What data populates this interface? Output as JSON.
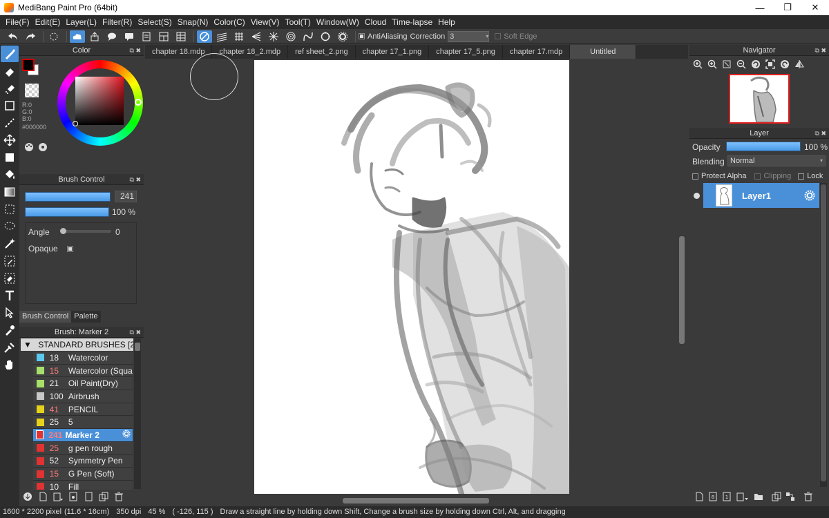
{
  "app": {
    "title": "MediBang Paint Pro (64bit)",
    "window_controls": [
      "—",
      "❐",
      "✕"
    ]
  },
  "menu": [
    "File(F)",
    "Edit(E)",
    "Layer(L)",
    "Filter(R)",
    "Select(S)",
    "Snap(N)",
    "Color(C)",
    "View(V)",
    "Tool(T)",
    "Window(W)",
    "Cloud",
    "Time-lapse",
    "Help"
  ],
  "toolbar": {
    "antialiasing_label": "AntiAliasing",
    "correction_label": "Correction",
    "correction_value": "3",
    "soft_edge_label": "Soft Edge"
  },
  "color_panel": {
    "title": "Color",
    "r": "R:0",
    "g": "G:0",
    "b": "B:0",
    "hex": "#000000",
    "foreground": "#000000",
    "background": "#ffffff",
    "accent": "#cc0000"
  },
  "brush_control": {
    "title": "Brush Control",
    "size_value": "241",
    "opacity_value": "100 %",
    "angle_label": "Angle",
    "angle_value": "0",
    "opaque_label": "Opaque",
    "tab_brush_control": "Brush Control",
    "tab_palette": "Palette"
  },
  "brush_panel": {
    "title": "Brush: Marker 2",
    "group": "STANDARD BRUSHES [2",
    "items": [
      {
        "size": "18",
        "name": "Watercolor",
        "color": "#5bc8f0",
        "size_color": "#eeeeee"
      },
      {
        "size": "15",
        "name": "Watercolor (Squa",
        "color": "#a6e06a",
        "size_color": "#ff7a7a"
      },
      {
        "size": "21",
        "name": "Oil Paint(Dry)",
        "color": "#a6e06a",
        "size_color": "#eeeeee"
      },
      {
        "size": "100",
        "name": "Airbrush",
        "color": "#c8c8c8",
        "size_color": "#eeeeee"
      },
      {
        "size": "41",
        "name": "PENCIL",
        "color": "#e6d21a",
        "size_color": "#ff7a7a"
      },
      {
        "size": "25",
        "name": "5",
        "color": "#e6d21a",
        "size_color": "#eeeeee"
      },
      {
        "size": "241",
        "name": "Marker 2",
        "color": "#e23232",
        "size_color": "#ff7a7a",
        "selected": true
      },
      {
        "size": "25",
        "name": "g pen rough",
        "color": "#e23232",
        "size_color": "#ff7a7a"
      },
      {
        "size": "52",
        "name": "Symmetry Pen",
        "color": "#e23232",
        "size_color": "#eeeeee"
      },
      {
        "size": "15",
        "name": "G Pen (Soft)",
        "color": "#e23232",
        "size_color": "#ff7a7a"
      },
      {
        "size": "10",
        "name": "Fill",
        "color": "#e23232",
        "size_color": "#eeeeee"
      }
    ]
  },
  "tabs": [
    "chapter 18.mdp",
    "chapter 18_2.mdp",
    "ref sheet_2.png",
    "chapter 17_1.png",
    "chapter 17_5.png",
    "chapter 17.mdp",
    "Untitled"
  ],
  "navigator": {
    "title": "Navigator"
  },
  "layer_panel": {
    "title": "Layer",
    "opacity_label": "Opacity",
    "opacity_value": "100 %",
    "blending_label": "Blending",
    "blending_value": "Normal",
    "protect_alpha": "Protect Alpha",
    "clipping": "Clipping",
    "lock": "Lock",
    "layer_name": "Layer1"
  },
  "status": {
    "size": "1600 * 2200 pixel",
    "dims": "(11.6 * 16cm)",
    "dpi": "350 dpi",
    "zoom": "45 %",
    "coords": "( -126, 115 )",
    "hint": "Draw a straight line by holding down Shift, Change a brush size by holding down Ctrl, Alt, and dragging"
  }
}
